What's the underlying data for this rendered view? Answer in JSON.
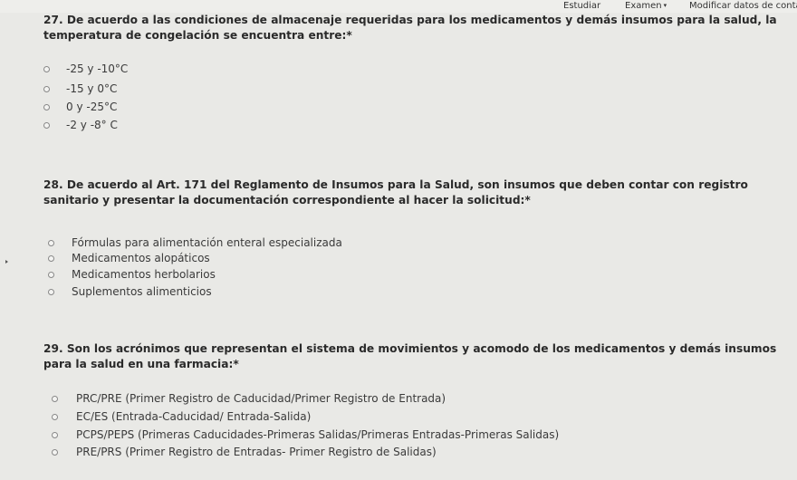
{
  "nav": {
    "studiar": "Estudiar",
    "examen": "Examen",
    "examen_caret": "▾",
    "modificar": "Modificar datos de conta"
  },
  "questions": [
    {
      "text": "27. De acuerdo a las condiciones de almacenaje requeridas para los medicamentos y demás insumos para la salud, la temperatura de congelación se encuentra entre:*",
      "options": [
        "-25 y -10°C",
        "-15 y 0°C",
        "0 y -25°C",
        "-2 y -8° C"
      ]
    },
    {
      "text": "28. De acuerdo al Art. 171 del Reglamento de Insumos para la Salud, son insumos que deben contar con registro sanitario y presentar la documentación correspondiente al hacer la solicitud:*",
      "options": [
        "Fórmulas para alimentación enteral especializada",
        "Medicamentos alopáticos",
        "Medicamentos herbolarios",
        "Suplementos alimenticios"
      ]
    },
    {
      "text": "29. Son los acrónimos que representan el sistema de movimientos y acomodo de los medicamentos y demás insumos para la salud en una farmacia:*",
      "options": [
        "PRC/PRE (Primer Registro de Caducidad/Primer Registro de Entrada)",
        "EC/ES (Entrada-Caducidad/ Entrada-Salida)",
        "PCPS/PEPS (Primeras Caducidades-Primeras Salidas/Primeras Entradas-Primeras Salidas)",
        "PRE/PRS (Primer Registro de Entradas- Primer Registro de Salidas)"
      ]
    }
  ],
  "colors": {
    "background": "#e9e9e6",
    "text": "#2c2c2c",
    "radio_border": "#888888"
  }
}
